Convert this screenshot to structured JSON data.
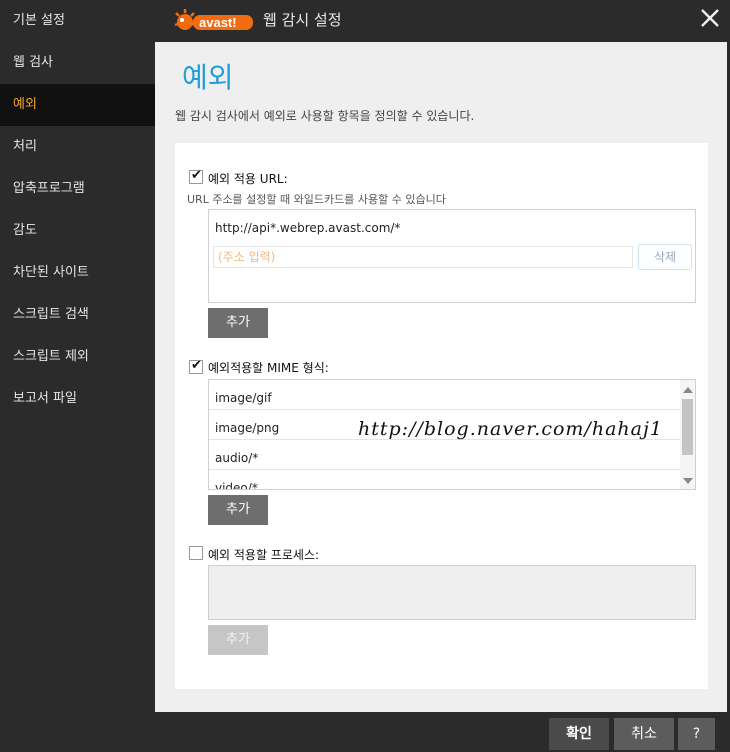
{
  "window": {
    "title": "웹 감시 설정",
    "brand": "avast!"
  },
  "sidebar": {
    "items": [
      {
        "label": "기본 설정"
      },
      {
        "label": "웹 검사"
      },
      {
        "label": "예외"
      },
      {
        "label": "처리"
      },
      {
        "label": "압축프로그램"
      },
      {
        "label": "감도"
      },
      {
        "label": "차단된 사이트"
      },
      {
        "label": "스크립트 검색"
      },
      {
        "label": "스크립트 제외"
      },
      {
        "label": "보고서 파일"
      }
    ],
    "active_index": 2
  },
  "main": {
    "title": "예외",
    "description": "웹 감시 검사에서 예외로 사용할 항목을 정의할 수 있습니다."
  },
  "url_section": {
    "checked": true,
    "label": "예외 적용 URL:",
    "hint": "URL 주소를 설정할 때 와일드카드를 사용할 수 있습니다",
    "entries": [
      "http://api*.webrep.avast.com/*"
    ],
    "input_placeholder": "(주소 입력)",
    "delete_label": "삭제",
    "add_label": "추가"
  },
  "mime_section": {
    "checked": true,
    "label": "예외적용할 MIME 형식:",
    "entries": [
      "image/gif",
      "image/png",
      "audio/*",
      "video/*"
    ],
    "add_label": "추가"
  },
  "process_section": {
    "checked": false,
    "label": "예외 적용할 프로세스:",
    "add_label": "추가"
  },
  "watermark": "http://blog.naver.com/hahaj1",
  "footer": {
    "ok": "확인",
    "cancel": "취소",
    "help": "?"
  },
  "colors": {
    "accent": "#1f9fd6",
    "active_item": "#f5a623",
    "logo_orange": "#f26b10"
  }
}
